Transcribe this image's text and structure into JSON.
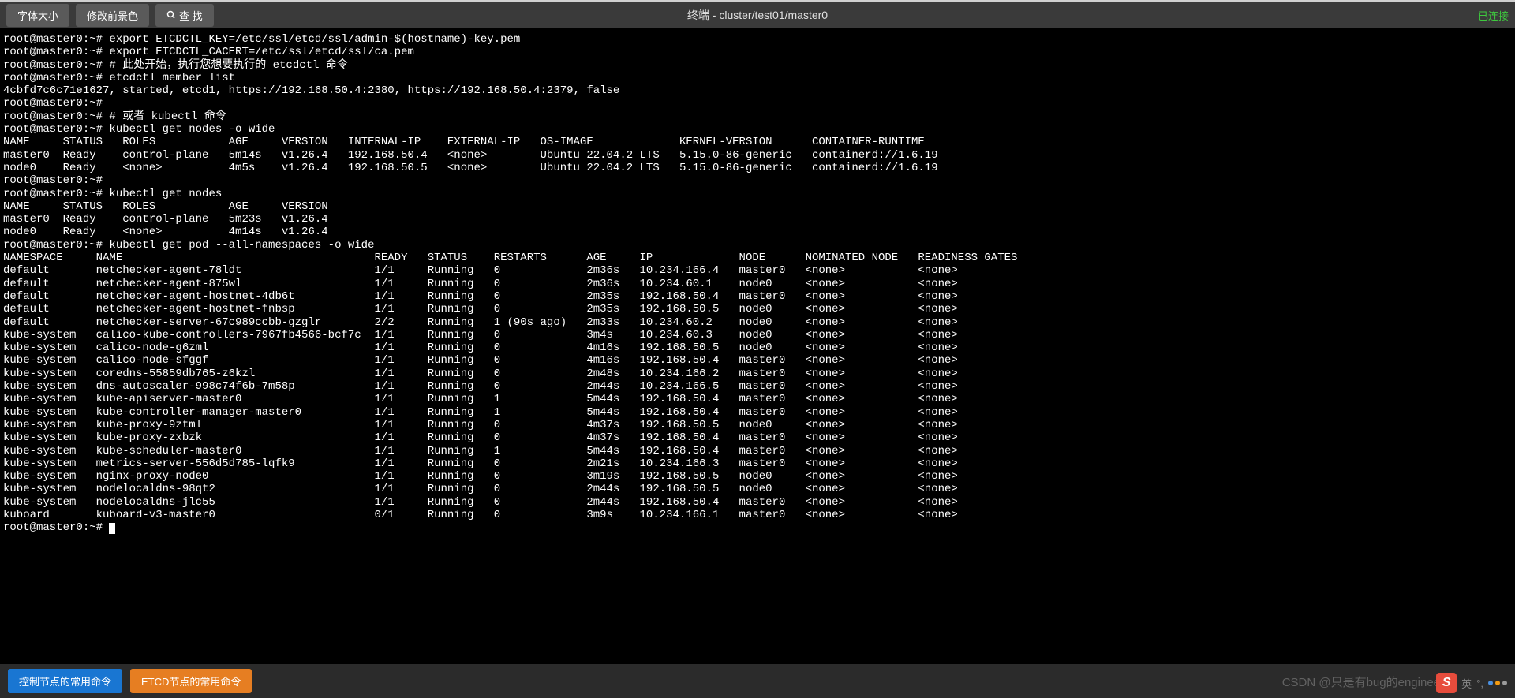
{
  "toolbar": {
    "font_size": "字体大小",
    "modify_fg": "修改前景色",
    "find": "查 找"
  },
  "title": "终端 - cluster/test01/master0",
  "status": "已连接",
  "bottom": {
    "control": "控制节点的常用命令",
    "etcd": "ETCD节点的常用命令"
  },
  "watermark": "CSDN @只是有bug的engineer",
  "ime": "英",
  "prompt": "root@master0:~#",
  "lines": [
    "root@master0:~# export ETCDCTL_KEY=/etc/ssl/etcd/ssl/admin-$(hostname)-key.pem",
    "root@master0:~# export ETCDCTL_CACERT=/etc/ssl/etcd/ssl/ca.pem",
    "root@master0:~# # 此处开始，执行您想要执行的 etcdctl 命令",
    "root@master0:~# etcdctl member list",
    "4cbfd7c6c71e1627, started, etcd1, https://192.168.50.4:2380, https://192.168.50.4:2379, false",
    "root@master0:~#",
    "root@master0:~# # 或者 kubectl 命令",
    "root@master0:~# kubectl get nodes -o wide"
  ],
  "nodes_wide_header": [
    "NAME",
    "STATUS",
    "ROLES",
    "AGE",
    "VERSION",
    "INTERNAL-IP",
    "EXTERNAL-IP",
    "OS-IMAGE",
    "KERNEL-VERSION",
    "CONTAINER-RUNTIME"
  ],
  "nodes_wide": [
    [
      "master0",
      "Ready",
      "control-plane",
      "5m14s",
      "v1.26.4",
      "192.168.50.4",
      "<none>",
      "Ubuntu 22.04.2 LTS",
      "5.15.0-86-generic",
      "containerd://1.6.19"
    ],
    [
      "node0",
      "Ready",
      "<none>",
      "4m5s",
      "v1.26.4",
      "192.168.50.5",
      "<none>",
      "Ubuntu 22.04.2 LTS",
      "5.15.0-86-generic",
      "containerd://1.6.19"
    ]
  ],
  "mid_lines": [
    "root@master0:~#",
    "root@master0:~# kubectl get nodes"
  ],
  "nodes_header": [
    "NAME",
    "STATUS",
    "ROLES",
    "AGE",
    "VERSION"
  ],
  "nodes": [
    [
      "master0",
      "Ready",
      "control-plane",
      "5m23s",
      "v1.26.4"
    ],
    [
      "node0",
      "Ready",
      "<none>",
      "4m14s",
      "v1.26.4"
    ]
  ],
  "pods_cmd": "root@master0:~# kubectl get pod --all-namespaces -o wide",
  "pods_header": [
    "NAMESPACE",
    "NAME",
    "READY",
    "STATUS",
    "RESTARTS",
    "AGE",
    "IP",
    "NODE",
    "NOMINATED NODE",
    "READINESS GATES"
  ],
  "pods": [
    [
      "default",
      "netchecker-agent-78ldt",
      "1/1",
      "Running",
      "0",
      "2m36s",
      "10.234.166.4",
      "master0",
      "<none>",
      "<none>"
    ],
    [
      "default",
      "netchecker-agent-875wl",
      "1/1",
      "Running",
      "0",
      "2m36s",
      "10.234.60.1",
      "node0",
      "<none>",
      "<none>"
    ],
    [
      "default",
      "netchecker-agent-hostnet-4db6t",
      "1/1",
      "Running",
      "0",
      "2m35s",
      "192.168.50.4",
      "master0",
      "<none>",
      "<none>"
    ],
    [
      "default",
      "netchecker-agent-hostnet-fnbsp",
      "1/1",
      "Running",
      "0",
      "2m35s",
      "192.168.50.5",
      "node0",
      "<none>",
      "<none>"
    ],
    [
      "default",
      "netchecker-server-67c989ccbb-gzglr",
      "2/2",
      "Running",
      "1 (90s ago)",
      "2m33s",
      "10.234.60.2",
      "node0",
      "<none>",
      "<none>"
    ],
    [
      "kube-system",
      "calico-kube-controllers-7967fb4566-bcf7c",
      "1/1",
      "Running",
      "0",
      "3m4s",
      "10.234.60.3",
      "node0",
      "<none>",
      "<none>"
    ],
    [
      "kube-system",
      "calico-node-g6zml",
      "1/1",
      "Running",
      "0",
      "4m16s",
      "192.168.50.5",
      "node0",
      "<none>",
      "<none>"
    ],
    [
      "kube-system",
      "calico-node-sfggf",
      "1/1",
      "Running",
      "0",
      "4m16s",
      "192.168.50.4",
      "master0",
      "<none>",
      "<none>"
    ],
    [
      "kube-system",
      "coredns-55859db765-z6kzl",
      "1/1",
      "Running",
      "0",
      "2m48s",
      "10.234.166.2",
      "master0",
      "<none>",
      "<none>"
    ],
    [
      "kube-system",
      "dns-autoscaler-998c74f6b-7m58p",
      "1/1",
      "Running",
      "0",
      "2m44s",
      "10.234.166.5",
      "master0",
      "<none>",
      "<none>"
    ],
    [
      "kube-system",
      "kube-apiserver-master0",
      "1/1",
      "Running",
      "1",
      "5m44s",
      "192.168.50.4",
      "master0",
      "<none>",
      "<none>"
    ],
    [
      "kube-system",
      "kube-controller-manager-master0",
      "1/1",
      "Running",
      "1",
      "5m44s",
      "192.168.50.4",
      "master0",
      "<none>",
      "<none>"
    ],
    [
      "kube-system",
      "kube-proxy-9ztml",
      "1/1",
      "Running",
      "0",
      "4m37s",
      "192.168.50.5",
      "node0",
      "<none>",
      "<none>"
    ],
    [
      "kube-system",
      "kube-proxy-zxbzk",
      "1/1",
      "Running",
      "0",
      "4m37s",
      "192.168.50.4",
      "master0",
      "<none>",
      "<none>"
    ],
    [
      "kube-system",
      "kube-scheduler-master0",
      "1/1",
      "Running",
      "1",
      "5m44s",
      "192.168.50.4",
      "master0",
      "<none>",
      "<none>"
    ],
    [
      "kube-system",
      "metrics-server-556d5d785-lqfk9",
      "1/1",
      "Running",
      "0",
      "2m21s",
      "10.234.166.3",
      "master0",
      "<none>",
      "<none>"
    ],
    [
      "kube-system",
      "nginx-proxy-node0",
      "1/1",
      "Running",
      "0",
      "3m19s",
      "192.168.50.5",
      "node0",
      "<none>",
      "<none>"
    ],
    [
      "kube-system",
      "nodelocaldns-98qt2",
      "1/1",
      "Running",
      "0",
      "2m44s",
      "192.168.50.5",
      "node0",
      "<none>",
      "<none>"
    ],
    [
      "kube-system",
      "nodelocaldns-jlc55",
      "1/1",
      "Running",
      "0",
      "2m44s",
      "192.168.50.4",
      "master0",
      "<none>",
      "<none>"
    ],
    [
      "kuboard",
      "kuboard-v3-master0",
      "0/1",
      "Running",
      "0",
      "3m9s",
      "10.234.166.1",
      "master0",
      "<none>",
      "<none>"
    ]
  ],
  "final_prompt": "root@master0:~# "
}
